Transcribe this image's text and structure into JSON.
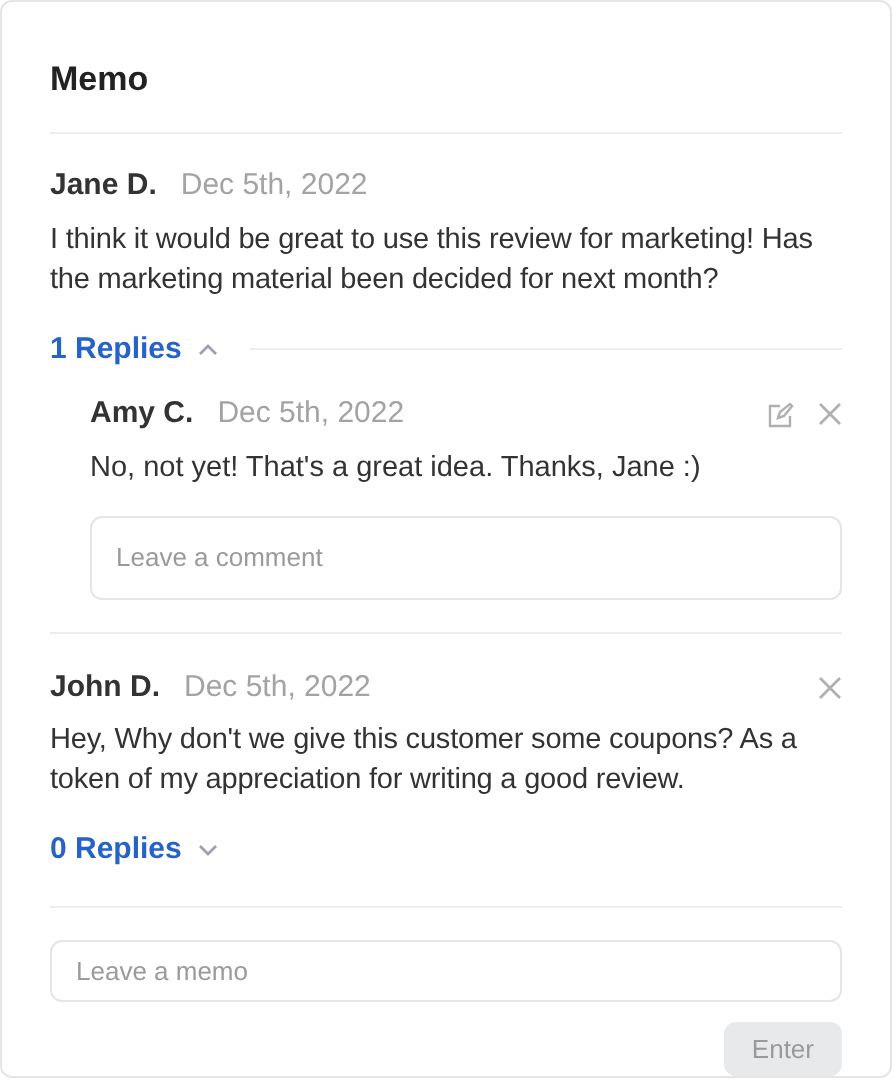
{
  "title": "Memo",
  "memos": [
    {
      "author": "Jane D.",
      "date": "Dec 5th, 2022",
      "body": "I think it would be great to use this review for marketing! Has the marketing material been decided for next month?",
      "deletable": false,
      "replies_label": "1 Replies",
      "expanded": true,
      "replies": [
        {
          "author": "Amy C.",
          "date": "Dec 5th, 2022",
          "body": "No, not yet! That's a great idea. Thanks, Jane :)",
          "editable": true,
          "deletable": true
        }
      ],
      "comment_placeholder": "Leave a comment"
    },
    {
      "author": "John D.",
      "date": "Dec 5th, 2022",
      "body": "Hey, Why don't we give this customer some coupons? As a token of my appreciation for writing a good review.",
      "deletable": true,
      "replies_label": "0 Replies",
      "expanded": false
    }
  ],
  "memo_field": {
    "placeholder": "Leave a memo"
  },
  "enter_button": {
    "label": "Enter",
    "disabled": true
  }
}
